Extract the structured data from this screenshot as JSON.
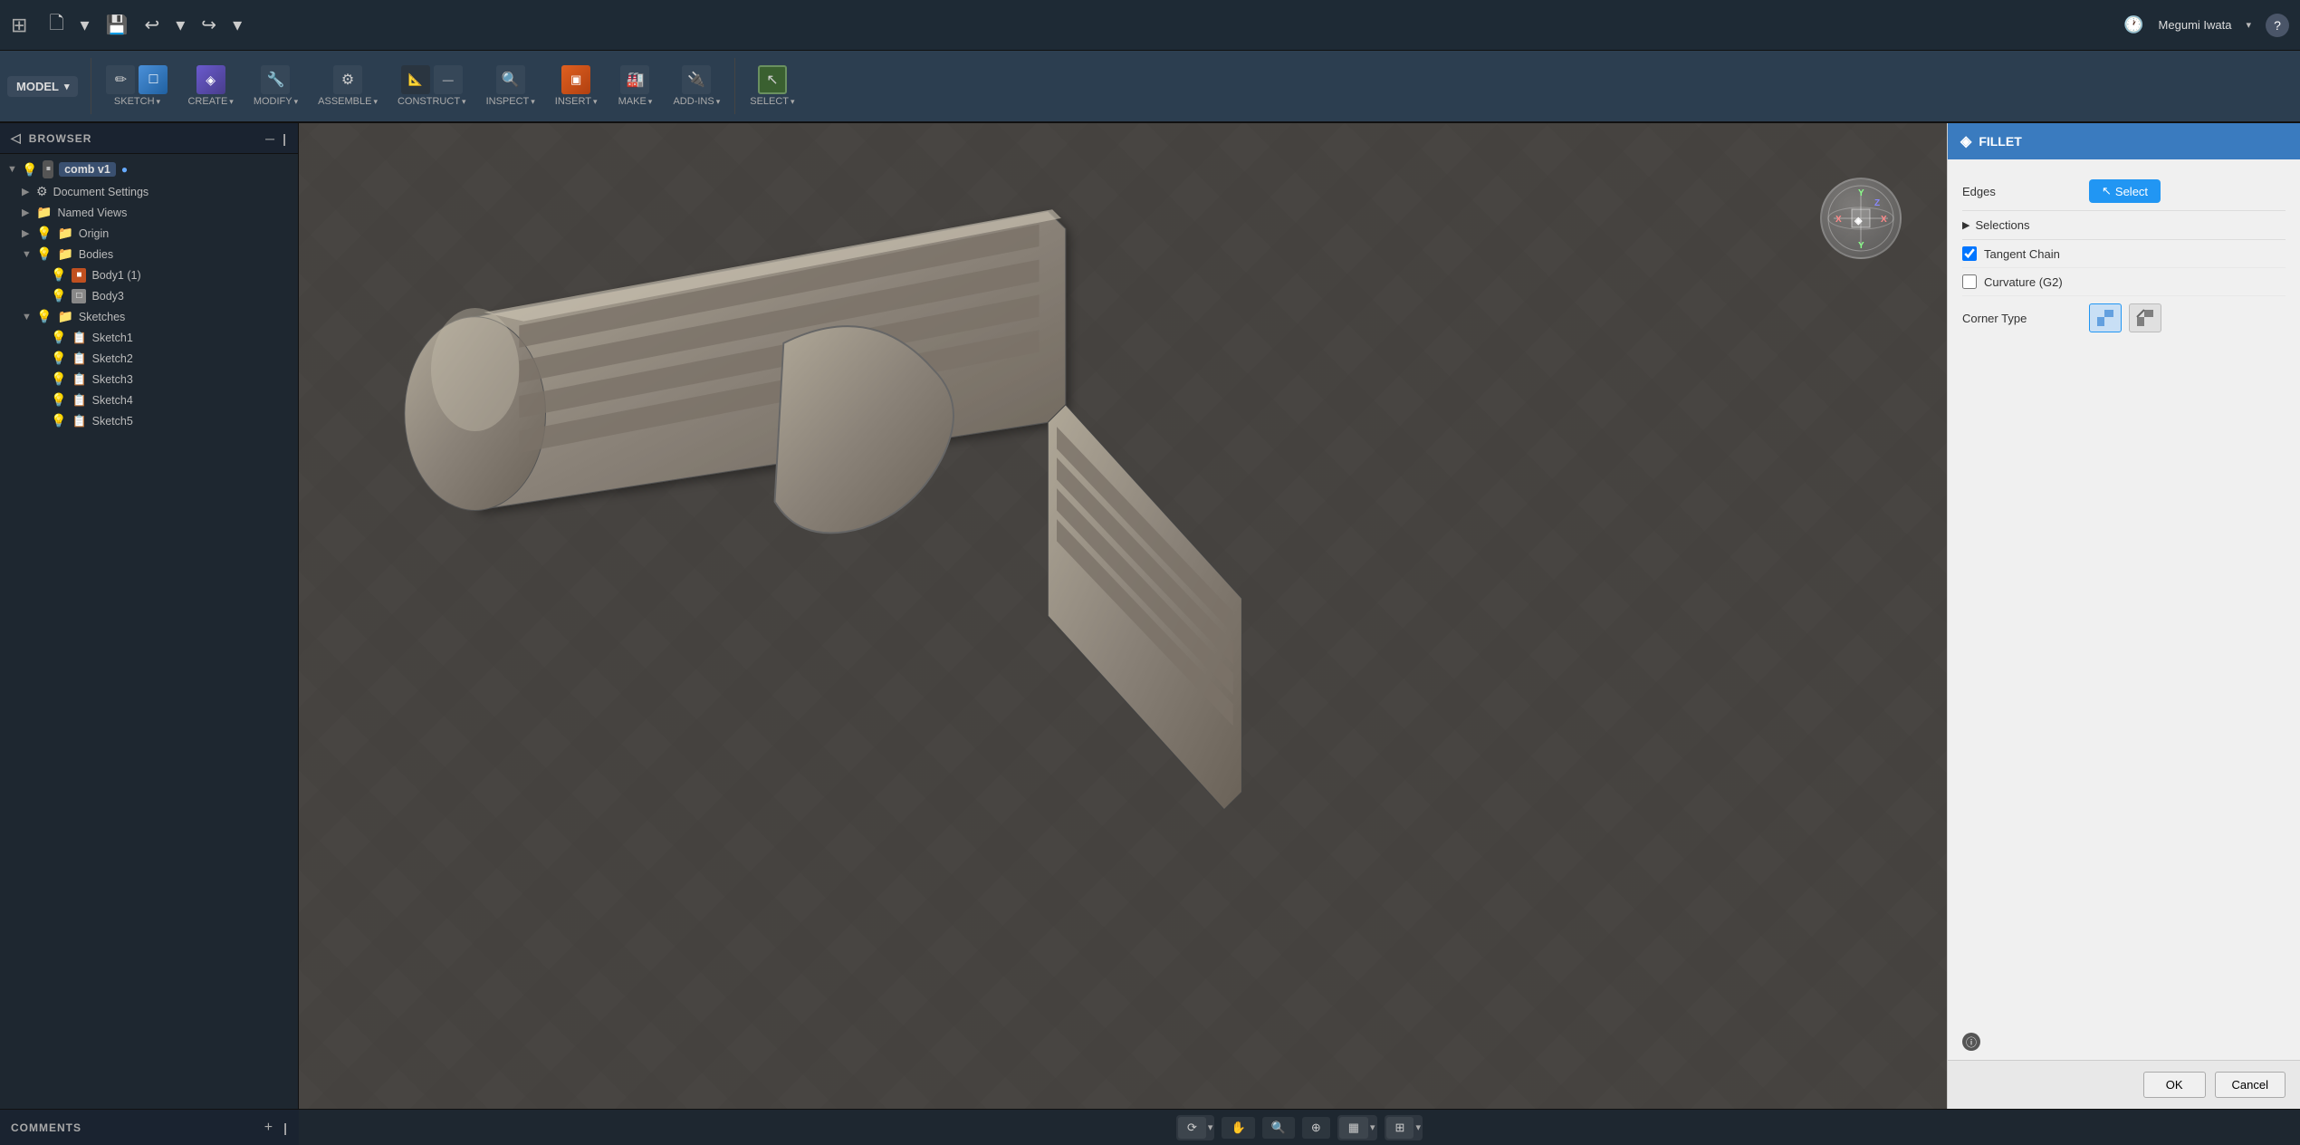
{
  "topbar": {
    "apps_icon": "⊞",
    "undo_icon": "↩",
    "redo_icon": "↪",
    "clock_icon": "🕐",
    "user_name": "Megumi Iwata",
    "help_icon": "?"
  },
  "toolbar": {
    "model_label": "MODEL",
    "sections": [
      {
        "id": "sketch",
        "label": "SKETCH",
        "icon": "✏️"
      },
      {
        "id": "create",
        "label": "CREATE",
        "icon": "🔷"
      },
      {
        "id": "modify",
        "label": "MODIFY",
        "icon": "🔧"
      },
      {
        "id": "assemble",
        "label": "ASSEMBLE",
        "icon": "🔩"
      },
      {
        "id": "construct",
        "label": "CONSTRUCT",
        "icon": "📐"
      },
      {
        "id": "inspect",
        "label": "INSPECT",
        "icon": "🔍"
      },
      {
        "id": "insert",
        "label": "INSERT",
        "icon": "📥"
      },
      {
        "id": "make",
        "label": "MAKE",
        "icon": "🏭"
      },
      {
        "id": "add-ins",
        "label": "ADD-INS",
        "icon": "🔌"
      },
      {
        "id": "select",
        "label": "SELECT",
        "icon": "↖️"
      }
    ]
  },
  "browser": {
    "header": "BROWSER",
    "tree": [
      {
        "id": "root",
        "label": "comb v1",
        "type": "component",
        "depth": 0,
        "expanded": true
      },
      {
        "id": "doc-settings",
        "label": "Document Settings",
        "type": "settings",
        "depth": 1,
        "expanded": false
      },
      {
        "id": "named-views",
        "label": "Named Views",
        "type": "folder",
        "depth": 1,
        "expanded": false
      },
      {
        "id": "origin",
        "label": "Origin",
        "type": "origin",
        "depth": 1,
        "expanded": false
      },
      {
        "id": "bodies",
        "label": "Bodies",
        "type": "folder",
        "depth": 1,
        "expanded": true
      },
      {
        "id": "body1",
        "label": "Body1 (1)",
        "type": "body",
        "depth": 2
      },
      {
        "id": "body3",
        "label": "Body3",
        "type": "body",
        "depth": 2
      },
      {
        "id": "sketches",
        "label": "Sketches",
        "type": "folder",
        "depth": 1,
        "expanded": true
      },
      {
        "id": "sketch1",
        "label": "Sketch1",
        "type": "sketch",
        "depth": 2
      },
      {
        "id": "sketch2",
        "label": "Sketch2",
        "type": "sketch",
        "depth": 2
      },
      {
        "id": "sketch3",
        "label": "Sketch3",
        "type": "sketch",
        "depth": 2
      },
      {
        "id": "sketch4",
        "label": "Sketch4",
        "type": "sketch",
        "depth": 2
      },
      {
        "id": "sketch5",
        "label": "Sketch5",
        "type": "sketch",
        "depth": 2
      }
    ]
  },
  "fillet_panel": {
    "title": "FILLET",
    "edges_label": "Edges",
    "select_button": "Select",
    "selections_label": "Selections",
    "tangent_chain_label": "Tangent Chain",
    "tangent_chain_checked": true,
    "curvature_label": "Curvature (G2)",
    "curvature_checked": false,
    "corner_type_label": "Corner Type",
    "ok_label": "OK",
    "cancel_label": "Cancel"
  },
  "comments": {
    "label": "COMMENTS",
    "add_icon": "+",
    "collapse_icon": "|"
  },
  "bottom_controls": {
    "orbit_icon": "↻",
    "pan_icon": "✋",
    "zoom_icon": "🔍",
    "fit_icon": "⊕",
    "display_icon": "▦",
    "grid_icon": "⊞"
  }
}
